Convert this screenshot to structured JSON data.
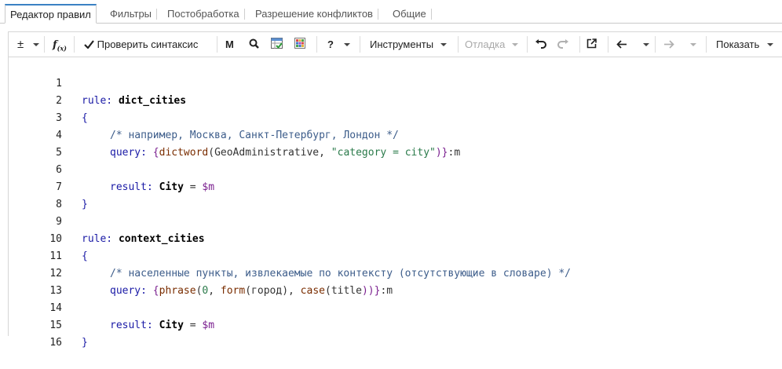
{
  "tabs": [
    {
      "label": "Редактор правил",
      "active": true
    },
    {
      "label": "Фильтры"
    },
    {
      "label": "Постобработка"
    },
    {
      "label": "Разрешение конфликтов"
    },
    {
      "label": "Общие"
    }
  ],
  "toolbar": {
    "plusminus": "±",
    "fx": "fx",
    "check_syntax": "Проверить синтаксис",
    "m_button": "M",
    "question": "?",
    "tools": "Инструменты",
    "debug": "Отладка",
    "show": "Показать"
  },
  "colors": {
    "accent": "#3b82c4",
    "comment": "#3c5c8a",
    "string": "#2a7a4a",
    "keyword": "#1a1aa6"
  },
  "editor": {
    "line_numbers": [
      "1",
      "2",
      "3",
      "4",
      "5",
      "6",
      "7",
      "8",
      "9",
      "10",
      "11",
      "12",
      "13",
      "14",
      "15",
      "16"
    ],
    "l1_kw": "rule:",
    "l1_name": "dict_cities",
    "l2": "{",
    "l3": "/* например, Москва, Санкт-Петербург, Лондон */",
    "l4_kw": "query:",
    "l4_open": "{",
    "l4_fn": "dictword",
    "l4_arg": "GeoAdministrative",
    "l4_str": "\"category = city\"",
    "l4_close": ")}",
    "l4_var": ":m",
    "l6_kw": "result:",
    "l6_type": "City",
    "l6_eq": " = ",
    "l6_var": "$m",
    "l7": "}",
    "l9_kw": "rule:",
    "l9_name": "context_cities",
    "l10": "{",
    "l11": "/* населенные пункты, извлекаемые по контексту (отсутствующие в словаре) */",
    "l12_kw": "query:",
    "l12_open": "{",
    "l12_fn1": "phrase",
    "l12_num": "0",
    "l12_fn2": "form",
    "l12_arg2": "город",
    "l12_fn3": "case",
    "l12_arg3": "title",
    "l12_close": "))}",
    "l12_var": ":m",
    "l14_kw": "result:",
    "l14_type": "City",
    "l14_eq": " = ",
    "l14_var": "$m",
    "l15": "}"
  }
}
